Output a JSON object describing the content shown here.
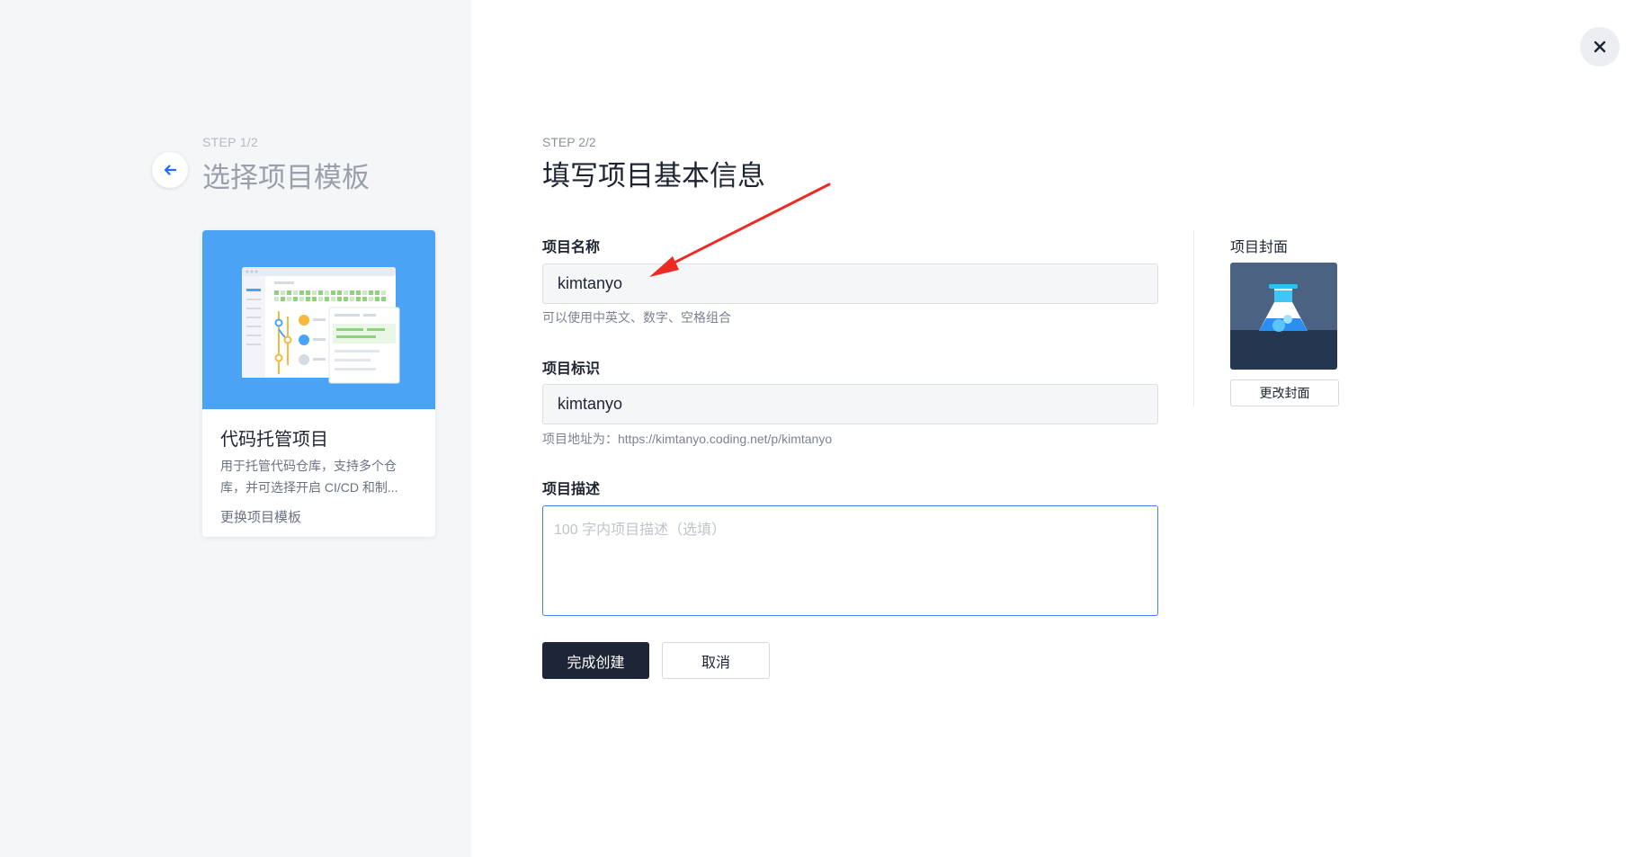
{
  "step1": {
    "label": "STEP 1/2",
    "title": "选择项目模板"
  },
  "template_card": {
    "title": "代码托管项目",
    "description": "用于托管代码仓库，支持多个仓库，并可选择开启 CI/CD 和制...",
    "change_label": "更换项目模板"
  },
  "step2": {
    "label": "STEP 2/2",
    "title": "填写项目基本信息"
  },
  "form": {
    "name_label": "项目名称",
    "name_value": "kimtanyo",
    "name_hint": "可以使用中英文、数字、空格组合",
    "id_label": "项目标识",
    "id_value": "kimtanyo",
    "id_hint": "项目地址为：https://kimtanyo.coding.net/p/kimtanyo",
    "desc_label": "项目描述",
    "desc_placeholder": "100 字内项目描述（选填）",
    "desc_value": ""
  },
  "cover": {
    "label": "项目封面",
    "change_label": "更改封面"
  },
  "actions": {
    "submit_label": "完成创建",
    "cancel_label": "取消"
  },
  "icons": {
    "back": "arrow-left-icon",
    "close": "close-icon",
    "cover": "flask-icon"
  },
  "colors": {
    "primary_button": "#1e2536",
    "focus_border": "#3b82f6",
    "template_bg": "#4ba3f5",
    "annotation_arrow": "#ee2a24"
  }
}
